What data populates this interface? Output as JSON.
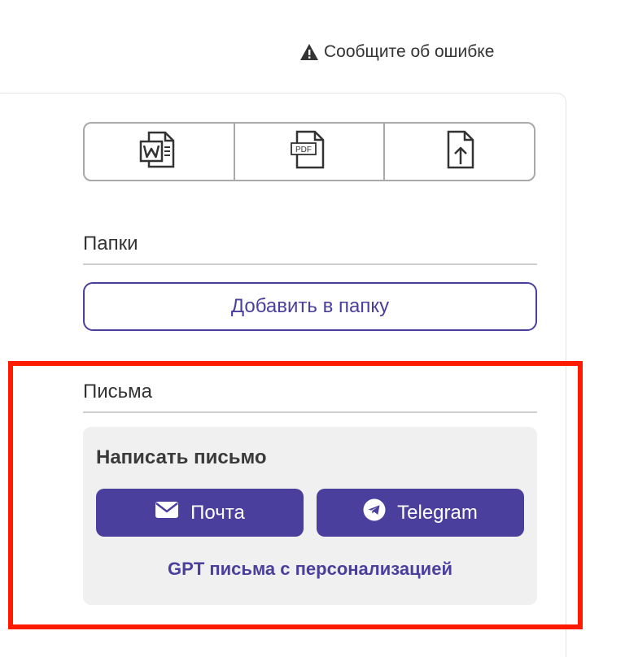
{
  "report": {
    "label": "Сообщите об ошибке",
    "icon": "warning-triangle-icon"
  },
  "export": {
    "buttons": [
      {
        "name": "word",
        "icon": "word-document-icon"
      },
      {
        "name": "pdf",
        "icon": "pdf-document-icon",
        "icon_text": "PDF"
      },
      {
        "name": "share",
        "icon": "share-upload-icon"
      }
    ]
  },
  "folders": {
    "title": "Папки",
    "add_button": "Добавить в папку"
  },
  "letters": {
    "title": "Письма",
    "write_title": "Написать письмо",
    "mail_button": "Почта",
    "mail_icon": "envelope-icon",
    "telegram_button": "Telegram",
    "telegram_icon": "telegram-icon",
    "gpt_link": "GPT письма с персонализацией"
  },
  "colors": {
    "accent": "#4b3f9e",
    "highlight": "#ff1a00",
    "panel_bg": "#f0f0f0"
  }
}
